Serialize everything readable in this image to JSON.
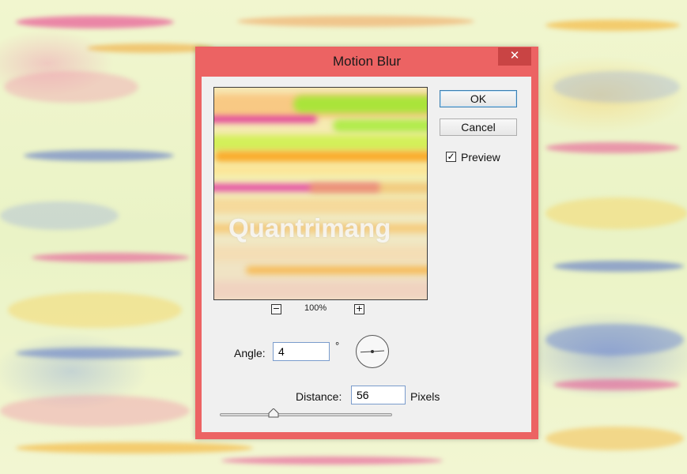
{
  "dialog": {
    "title": "Motion Blur",
    "close_label": "✕"
  },
  "buttons": {
    "ok_label": "OK",
    "cancel_label": "Cancel"
  },
  "preview_checkbox": {
    "label": "Preview",
    "checked": true,
    "check_glyph": "✓"
  },
  "preview_area": {
    "watermark": "Quantrimang",
    "zoom_out_glyph": "−",
    "zoom_in_glyph": "+",
    "zoom_level": "100%"
  },
  "angle": {
    "label": "Angle:",
    "value": "4",
    "unit": "°"
  },
  "distance": {
    "label": "Distance:",
    "value": "56",
    "unit": "Pixels"
  },
  "colors": {
    "dialog_frame": "#ec6363",
    "client_bg": "#f0f0f0",
    "accent_field_border": "#7a9ccc"
  }
}
